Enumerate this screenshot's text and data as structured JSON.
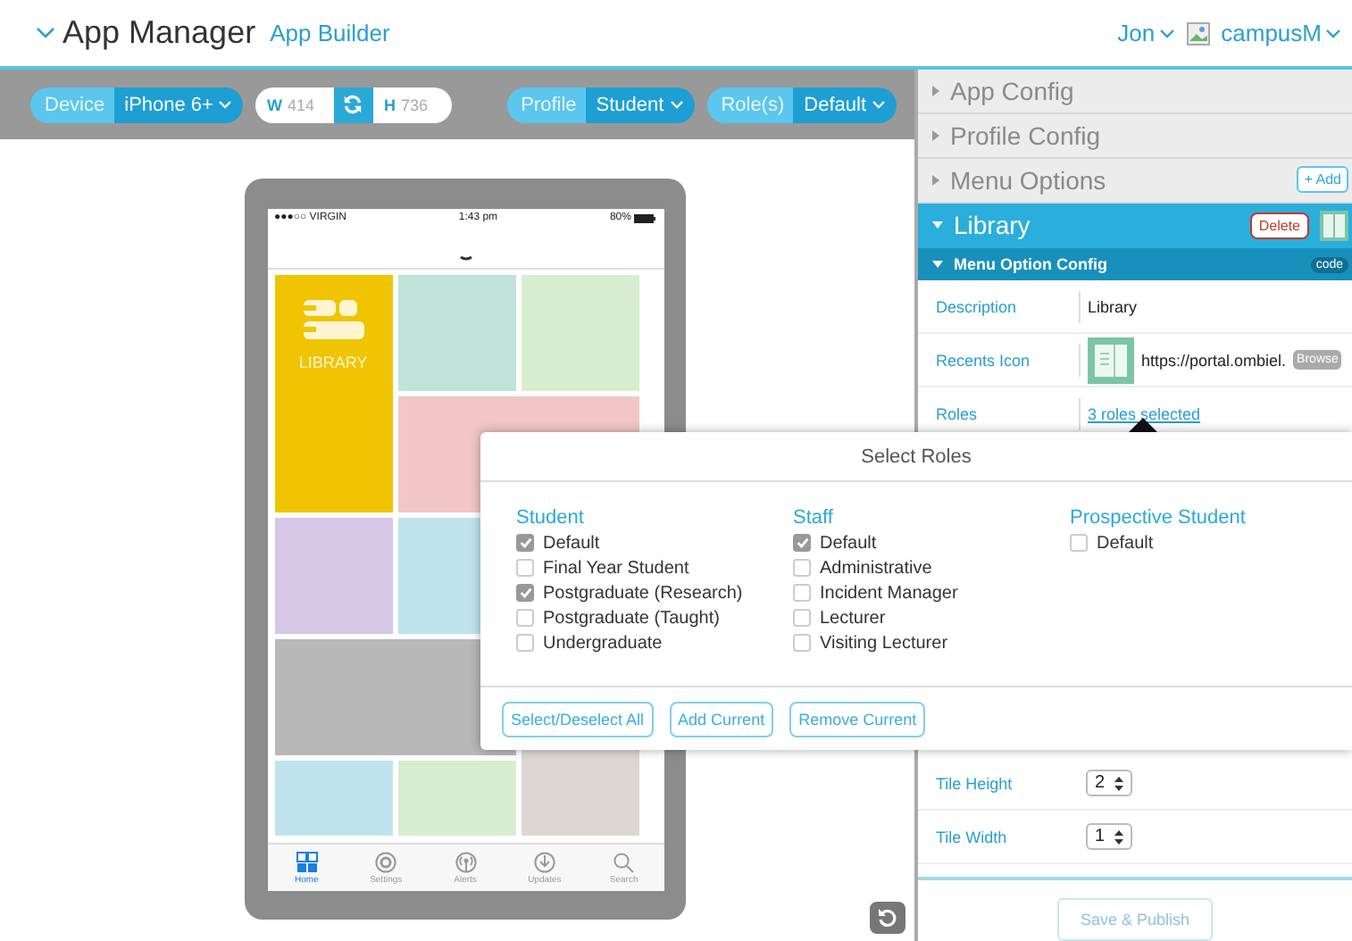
{
  "header": {
    "title": "App Manager",
    "subtitle": "App Builder",
    "user": "Jon",
    "org": "campusM"
  },
  "toolbar": {
    "selects": [
      {
        "label": "Device",
        "value": "iPhone 6+"
      },
      {
        "label": "Profile",
        "value": "Student"
      },
      {
        "label": "Role(s)",
        "value": "Default"
      }
    ],
    "size": {
      "width_label": "W",
      "width_placeholder": "414",
      "height_label": "H",
      "height_placeholder": "736"
    }
  },
  "phone": {
    "status": {
      "carrier": "●●●○○ VIRGIN",
      "time": "1:43 pm",
      "battery": "80%"
    },
    "tiles": [
      {
        "kind": "library",
        "label": "LIBRARY",
        "color": "#f0c400"
      },
      {
        "kind": "plain",
        "color": "#bfe3da"
      },
      {
        "kind": "plain",
        "color": "#d8edcf"
      },
      {
        "kind": "plain",
        "color": "#f2c6c6"
      },
      {
        "kind": "plain",
        "color": "#d6c7e6"
      },
      {
        "kind": "plain",
        "color": "#bfe4ee"
      },
      {
        "kind": "plain",
        "color": "#b8b8b8"
      },
      {
        "kind": "plain",
        "color": "#ddd6d2"
      },
      {
        "kind": "plain",
        "color": "#bfe4ee"
      },
      {
        "kind": "plain",
        "color": "#d8edcf"
      }
    ],
    "tabs": [
      {
        "label": "Home",
        "kind": "home",
        "selected": true
      },
      {
        "label": "Settings",
        "kind": "settings",
        "selected": false
      },
      {
        "label": "Alerts",
        "kind": "alerts",
        "selected": false
      },
      {
        "label": "Updates",
        "kind": "updates",
        "selected": false
      },
      {
        "label": "Search",
        "kind": "search",
        "selected": false
      }
    ]
  },
  "panel": {
    "sections": [
      {
        "label": "App Config"
      },
      {
        "label": "Profile Config"
      },
      {
        "label": "Menu Options",
        "action": "+ Add"
      }
    ],
    "item": {
      "title": "Library",
      "delete": "Delete",
      "subtitle": "Menu Option Config",
      "badge": "code"
    },
    "fields": [
      {
        "kind": "text",
        "label": "Description",
        "value": "Library"
      },
      {
        "kind": "icon",
        "label": "Recents Icon",
        "value": "https://portal.ombiel.",
        "button": "Browse"
      },
      {
        "kind": "link",
        "label": "Roles",
        "value": "3 roles selected"
      }
    ],
    "tile_fields": [
      {
        "label": "Tile Height",
        "value": "2"
      },
      {
        "label": "Tile Width",
        "value": "1"
      }
    ],
    "save": {
      "label": "Save & Publish",
      "disabled": true
    }
  },
  "modal": {
    "title": "Select Roles",
    "groups": [
      {
        "name": "Student",
        "roles": [
          {
            "label": "Default",
            "checked": true
          },
          {
            "label": "Final Year Student",
            "checked": false
          },
          {
            "label": "Postgraduate (Research)",
            "checked": true
          },
          {
            "label": "Postgraduate (Taught)",
            "checked": false
          },
          {
            "label": "Undergraduate",
            "checked": false
          }
        ]
      },
      {
        "name": "Staff",
        "roles": [
          {
            "label": "Default",
            "checked": true
          },
          {
            "label": "Administrative",
            "checked": false
          },
          {
            "label": "Incident Manager",
            "checked": false
          },
          {
            "label": "Lecturer",
            "checked": false
          },
          {
            "label": "Visiting Lecturer",
            "checked": false
          }
        ]
      },
      {
        "name": "Prospective Student",
        "roles": [
          {
            "label": "Default",
            "checked": false
          }
        ]
      }
    ],
    "buttons": [
      "Select/Deselect All",
      "Add Current",
      "Remove Current"
    ]
  }
}
